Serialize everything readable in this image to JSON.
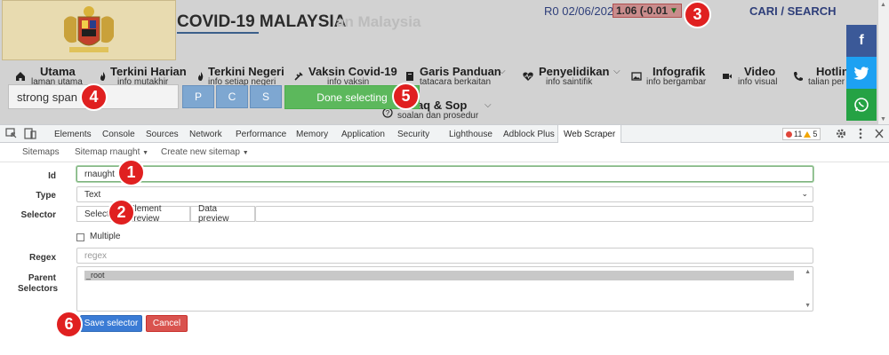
{
  "site": {
    "title": "COVID-19 MALAYSIA",
    "title_ghost": "an Malaysia",
    "rt_date": "R0 02/06/2021",
    "rt_value": "1.06 (-0.01",
    "rt_close": ")",
    "search": "CARI / SEARCH",
    "nav": [
      {
        "label": "Utama",
        "sub": "laman utama"
      },
      {
        "label": "Terkini Harian",
        "sub": "info mutakhir"
      },
      {
        "label": "Terkini Negeri",
        "sub": "info setiap negeri"
      },
      {
        "label": "Vaksin Covid-19",
        "sub": "info vaksin"
      },
      {
        "label": "Garis Panduan",
        "sub": "tatacara berkaitan"
      },
      {
        "label": "Penyelidikan",
        "sub": "info saintifik"
      },
      {
        "label": "Infografik",
        "sub": "info bergambar"
      },
      {
        "label": "Video",
        "sub": "info visual"
      },
      {
        "label": "Hotlin",
        "sub": "talian per"
      },
      {
        "label": "Faq & Sop",
        "sub": "soalan dan prosedur"
      }
    ],
    "social": [
      "f",
      "t",
      "w"
    ]
  },
  "selector_bar": {
    "input_value": "strong span",
    "btn_p": "P",
    "btn_c": "C",
    "btn_s": "S",
    "done": "Done selecting"
  },
  "devtools": {
    "tabs": [
      "Elements",
      "Console",
      "Sources",
      "Network",
      "Performance",
      "Memory",
      "Application",
      "Security",
      "Lighthouse",
      "Adblock Plus",
      "Web Scraper"
    ],
    "errors": "11",
    "warnings": "5"
  },
  "scraper": {
    "nav": {
      "sitemaps": "Sitemaps",
      "sitemap": "Sitemap rnaught",
      "create": "Create new sitemap"
    },
    "labels": {
      "id": "Id",
      "type": "Type",
      "selector": "Selector",
      "regex": "Regex",
      "parent_1": "Parent",
      "parent_2": "Selectors"
    },
    "id_value": "rnaught",
    "type_value": "Text",
    "select_btn": "Select",
    "select_hidden": "Element preview",
    "data_preview": "Data preview",
    "multiple": "Multiple",
    "regex_placeholder": "regex",
    "parent_option": "_root",
    "save": "Save selector",
    "cancel": "Cancel"
  },
  "callouts": [
    "1",
    "2",
    "3",
    "4",
    "5",
    "6"
  ],
  "colors": {
    "callout": "#e02020",
    "done": "#5cb85c",
    "save": "#3a7bd5",
    "cancel": "#d9534f",
    "pcs": "#7ea7d1"
  }
}
